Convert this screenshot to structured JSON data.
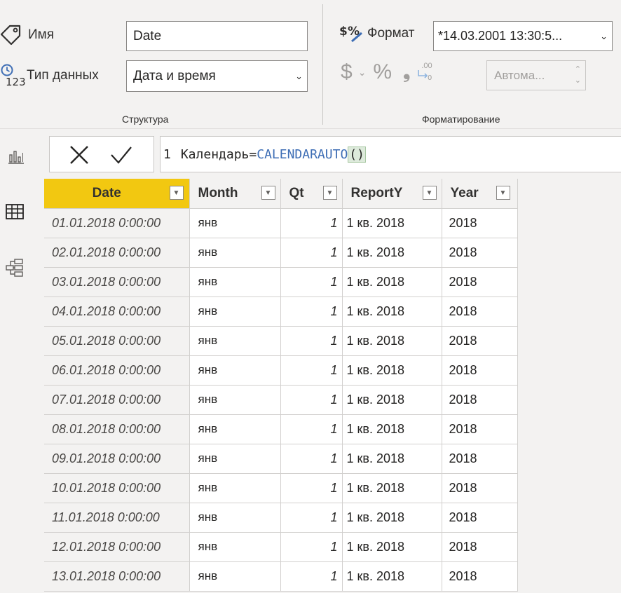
{
  "ribbon": {
    "name_label": "Имя",
    "name_value": "Date",
    "type_label": "Тип данных",
    "type_value": "Дата и время",
    "structure_group": "Структура",
    "format_label": "Формат",
    "format_value": "*14.03.2001 13:30:5...",
    "currency_symbol": "$",
    "percent_symbol": "%",
    "comma_symbol": "❟",
    "decimals_symbol": ".00",
    "auto_value": "Автома...",
    "formatting_group": "Форматирование"
  },
  "rail": {
    "icons": [
      "report-view-icon",
      "data-view-icon",
      "model-view-icon"
    ]
  },
  "formula": {
    "line_number": "1",
    "table_name": "Календарь",
    "operator": "=",
    "function": "CALENDARAUTO",
    "paren": "()"
  },
  "table": {
    "columns": [
      "Date",
      "Month",
      "Qt",
      "ReportY",
      "Year"
    ],
    "rows": [
      [
        "01.01.2018 0:00:00",
        "янв",
        "1",
        "1 кв. 2018",
        "2018"
      ],
      [
        "02.01.2018 0:00:00",
        "янв",
        "1",
        "1 кв. 2018",
        "2018"
      ],
      [
        "03.01.2018 0:00:00",
        "янв",
        "1",
        "1 кв. 2018",
        "2018"
      ],
      [
        "04.01.2018 0:00:00",
        "янв",
        "1",
        "1 кв. 2018",
        "2018"
      ],
      [
        "05.01.2018 0:00:00",
        "янв",
        "1",
        "1 кв. 2018",
        "2018"
      ],
      [
        "06.01.2018 0:00:00",
        "янв",
        "1",
        "1 кв. 2018",
        "2018"
      ],
      [
        "07.01.2018 0:00:00",
        "янв",
        "1",
        "1 кв. 2018",
        "2018"
      ],
      [
        "08.01.2018 0:00:00",
        "янв",
        "1",
        "1 кв. 2018",
        "2018"
      ],
      [
        "09.01.2018 0:00:00",
        "янв",
        "1",
        "1 кв. 2018",
        "2018"
      ],
      [
        "10.01.2018 0:00:00",
        "янв",
        "1",
        "1 кв. 2018",
        "2018"
      ],
      [
        "11.01.2018 0:00:00",
        "янв",
        "1",
        "1 кв. 2018",
        "2018"
      ],
      [
        "12.01.2018 0:00:00",
        "янв",
        "1",
        "1 кв. 2018",
        "2018"
      ],
      [
        "13.01.2018 0:00:00",
        "янв",
        "1",
        "1 кв. 2018",
        "2018"
      ]
    ]
  },
  "colors": {
    "selected_header": "#f2c811",
    "function_blue": "#3e6eb5",
    "paren_highlight": "#ddeadb"
  }
}
